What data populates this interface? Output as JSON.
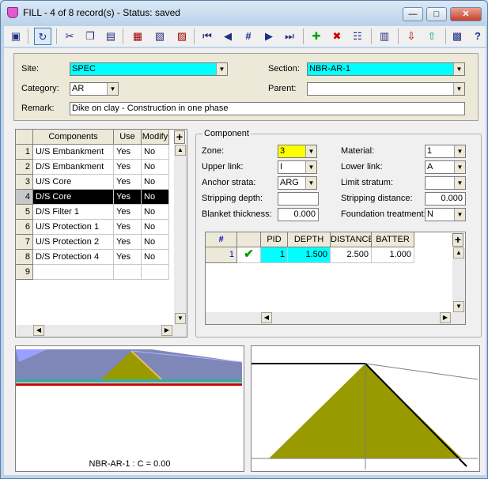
{
  "window": {
    "title": "FILL - 4 of 8 record(s) - Status: saved",
    "minimize": "—",
    "maximize": "□",
    "close": "✕"
  },
  "toolbar": {
    "icons": [
      "save-icon",
      "refresh-icon",
      "cut-icon",
      "copy-icon",
      "paste-icon",
      "new-record-icon",
      "copy-record-icon",
      "delete-record-icon",
      "first-record-icon",
      "prev-record-icon",
      "goto-record-icon",
      "next-record-icon",
      "last-record-icon",
      "add-icon",
      "remove-icon",
      "tree-icon",
      "book-icon",
      "import-icon",
      "export-icon",
      "options-icon",
      "help-icon"
    ],
    "glyphs": {
      "save": "▣",
      "refresh": "↻",
      "cut": "✂",
      "copy": "❐",
      "paste": "▤",
      "new": "▦",
      "copyrec": "▧",
      "delrec": "▨",
      "first": "⏮",
      "prev": "◀",
      "goto": "#",
      "next": "▶",
      "last": "⏭",
      "add": "✚",
      "remove": "✖",
      "tree": "☷",
      "book": "▥",
      "import": "⇩",
      "export": "⇧",
      "options": "▩",
      "help": "?"
    }
  },
  "header": {
    "site_label": "Site:",
    "site_value": "SPEC",
    "section_label": "Section:",
    "section_value": "NBR-AR-1",
    "category_label": "Category:",
    "category_value": "AR",
    "parent_label": "Parent:",
    "parent_value": "",
    "remark_label": "Remark:",
    "remark_value": "Dike on clay - Construction in one phase"
  },
  "components": {
    "columns": [
      "Components",
      "Use",
      "Modify"
    ],
    "rows": [
      {
        "n": "1",
        "name": "U/S Embankment",
        "use": "Yes",
        "modify": "No"
      },
      {
        "n": "2",
        "name": "D/S Embankment",
        "use": "Yes",
        "modify": "No"
      },
      {
        "n": "3",
        "name": "U/S Core",
        "use": "Yes",
        "modify": "No"
      },
      {
        "n": "4",
        "name": "D/S Core",
        "use": "Yes",
        "modify": "No"
      },
      {
        "n": "5",
        "name": "D/S Filter 1",
        "use": "Yes",
        "modify": "No"
      },
      {
        "n": "6",
        "name": "U/S Protection 1",
        "use": "Yes",
        "modify": "No"
      },
      {
        "n": "7",
        "name": "U/S Protection 2",
        "use": "Yes",
        "modify": "No"
      },
      {
        "n": "8",
        "name": "D/S Protection 4",
        "use": "Yes",
        "modify": "No"
      },
      {
        "n": "9",
        "name": "",
        "use": "",
        "modify": ""
      }
    ],
    "selected_index": 3
  },
  "component": {
    "group_label": "Component",
    "zone_label": "Zone:",
    "zone_value": "3",
    "material_label": "Material:",
    "material_value": "1",
    "upper_link_label": "Upper link:",
    "upper_link_value": "I",
    "lower_link_label": "Lower link:",
    "lower_link_value": "A",
    "anchor_strata_label": "Anchor strata:",
    "anchor_strata_value": "ARG",
    "limit_stratum_label": "Limit stratum:",
    "limit_stratum_value": "",
    "stripping_depth_label": "Stripping depth:",
    "stripping_depth_value": "",
    "stripping_distance_label": "Stripping distance:",
    "stripping_distance_value": "0.000",
    "blanket_thickness_label": "Blanket thickness:",
    "blanket_thickness_value": "0.000",
    "foundation_treatment_label": "Foundation treatment:",
    "foundation_treatment_value": "N"
  },
  "points": {
    "columns": [
      "#",
      "",
      "PID",
      "DEPTH",
      "DISTANCE",
      "BATTER"
    ],
    "rows": [
      {
        "n": "1",
        "check": "✔",
        "pid": "1",
        "depth": "1.500",
        "distance": "2.500",
        "batter": "1.000"
      }
    ]
  },
  "preview": {
    "caption": "NBR-AR-1 : C = 0.00"
  },
  "colors": {
    "cyan": "#00ffff",
    "yellow": "#ffff00",
    "olive": "#999900",
    "slate": "#7f86b8",
    "green": "#00a000"
  }
}
